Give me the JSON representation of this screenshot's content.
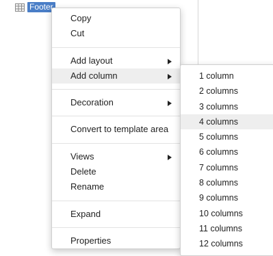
{
  "tree": {
    "node_label": "Footer",
    "node_icon": "grid-icon"
  },
  "context_menu": {
    "items": [
      {
        "label": "Copy"
      },
      {
        "label": "Cut"
      },
      {
        "label": "Add layout",
        "icon": "chevron-right-icon"
      },
      {
        "label": "Add column",
        "icon": "chevron-right-icon"
      },
      {
        "label": "Decoration",
        "icon": "chevron-right-icon"
      },
      {
        "label": "Convert to template area"
      },
      {
        "label": "Views",
        "icon": "chevron-right-icon"
      },
      {
        "label": "Delete"
      },
      {
        "label": "Rename"
      },
      {
        "label": "Expand"
      },
      {
        "label": "Properties"
      }
    ]
  },
  "submenu": {
    "items": [
      "1 column",
      "2 columns",
      "3 columns",
      "4 columns",
      "5 columns",
      "6 columns",
      "7 columns",
      "8 columns",
      "9 columns",
      "10 columns",
      "11 columns",
      "12 columns"
    ]
  },
  "colors": {
    "selection": "#4a7ec7",
    "hover": "#eeeeee"
  }
}
